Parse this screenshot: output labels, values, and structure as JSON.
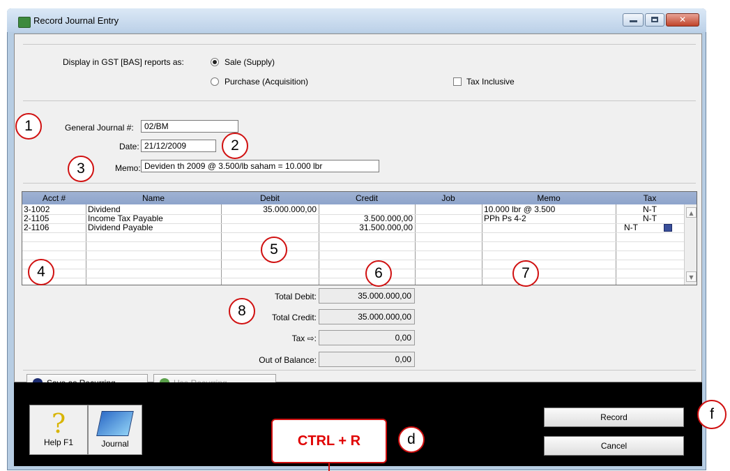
{
  "window": {
    "title": "Record Journal Entry",
    "close_glyph": "✕"
  },
  "gst": {
    "label": "Display in GST [BAS] reports as:",
    "option_sale": "Sale (Supply)",
    "option_purchase": "Purchase (Acquisition)",
    "selected": "Sale (Supply)",
    "tax_inclusive_label": "Tax Inclusive",
    "tax_inclusive_checked": false
  },
  "form": {
    "journal_label": "General Journal #:",
    "journal_value": "02/BM",
    "date_label": "Date:",
    "date_value": "21/12/2009",
    "memo_label": "Memo:",
    "memo_value": "Deviden th 2009 @ 3.500/lb saham = 10.000 lbr"
  },
  "table": {
    "columns": [
      "Acct #",
      "Name",
      "Debit",
      "Credit",
      "Job",
      "Memo",
      "Tax"
    ],
    "rows": [
      {
        "acct": "3-1002",
        "name": "Dividend",
        "debit": "35.000.000,00",
        "credit": "",
        "job": "",
        "memo": "10.000 lbr @ 3.500",
        "tax": "N-T"
      },
      {
        "acct": "2-1105",
        "name": "Income Tax Payable",
        "debit": "",
        "credit": "3.500.000,00",
        "job": "",
        "memo": "PPh Ps 4-2",
        "tax": "N-T"
      },
      {
        "acct": "2-1106",
        "name": "Dividend Payable",
        "debit": "",
        "credit": "31.500.000,00",
        "job": "",
        "memo": "",
        "tax": "N-T"
      }
    ]
  },
  "totals": {
    "total_debit_label": "Total Debit:",
    "total_debit": "35.000.000,00",
    "total_credit_label": "Total Credit:",
    "total_credit": "35.000.000,00",
    "tax_label": "Tax ⇨:",
    "tax": "0,00",
    "out_of_balance_label": "Out of Balance:",
    "out_of_balance": "0,00"
  },
  "recurring": {
    "save_label": "Save as Recurring",
    "use_label": "Use Recurring"
  },
  "footer": {
    "help_label": "Help F1",
    "journal_label": "Journal",
    "record_label": "Record",
    "cancel_label": "Cancel"
  },
  "annotations": {
    "n1": "1",
    "n2": "2",
    "n3": "3",
    "n4": "4",
    "n5": "5",
    "n6": "6",
    "n7": "7",
    "n8": "8",
    "d": "d",
    "f": "f",
    "shortcut": "CTRL + R"
  },
  "colors": {
    "annotation": "#d01010",
    "header": "#9fb2d3",
    "titlebar": "#bcd1e8"
  }
}
